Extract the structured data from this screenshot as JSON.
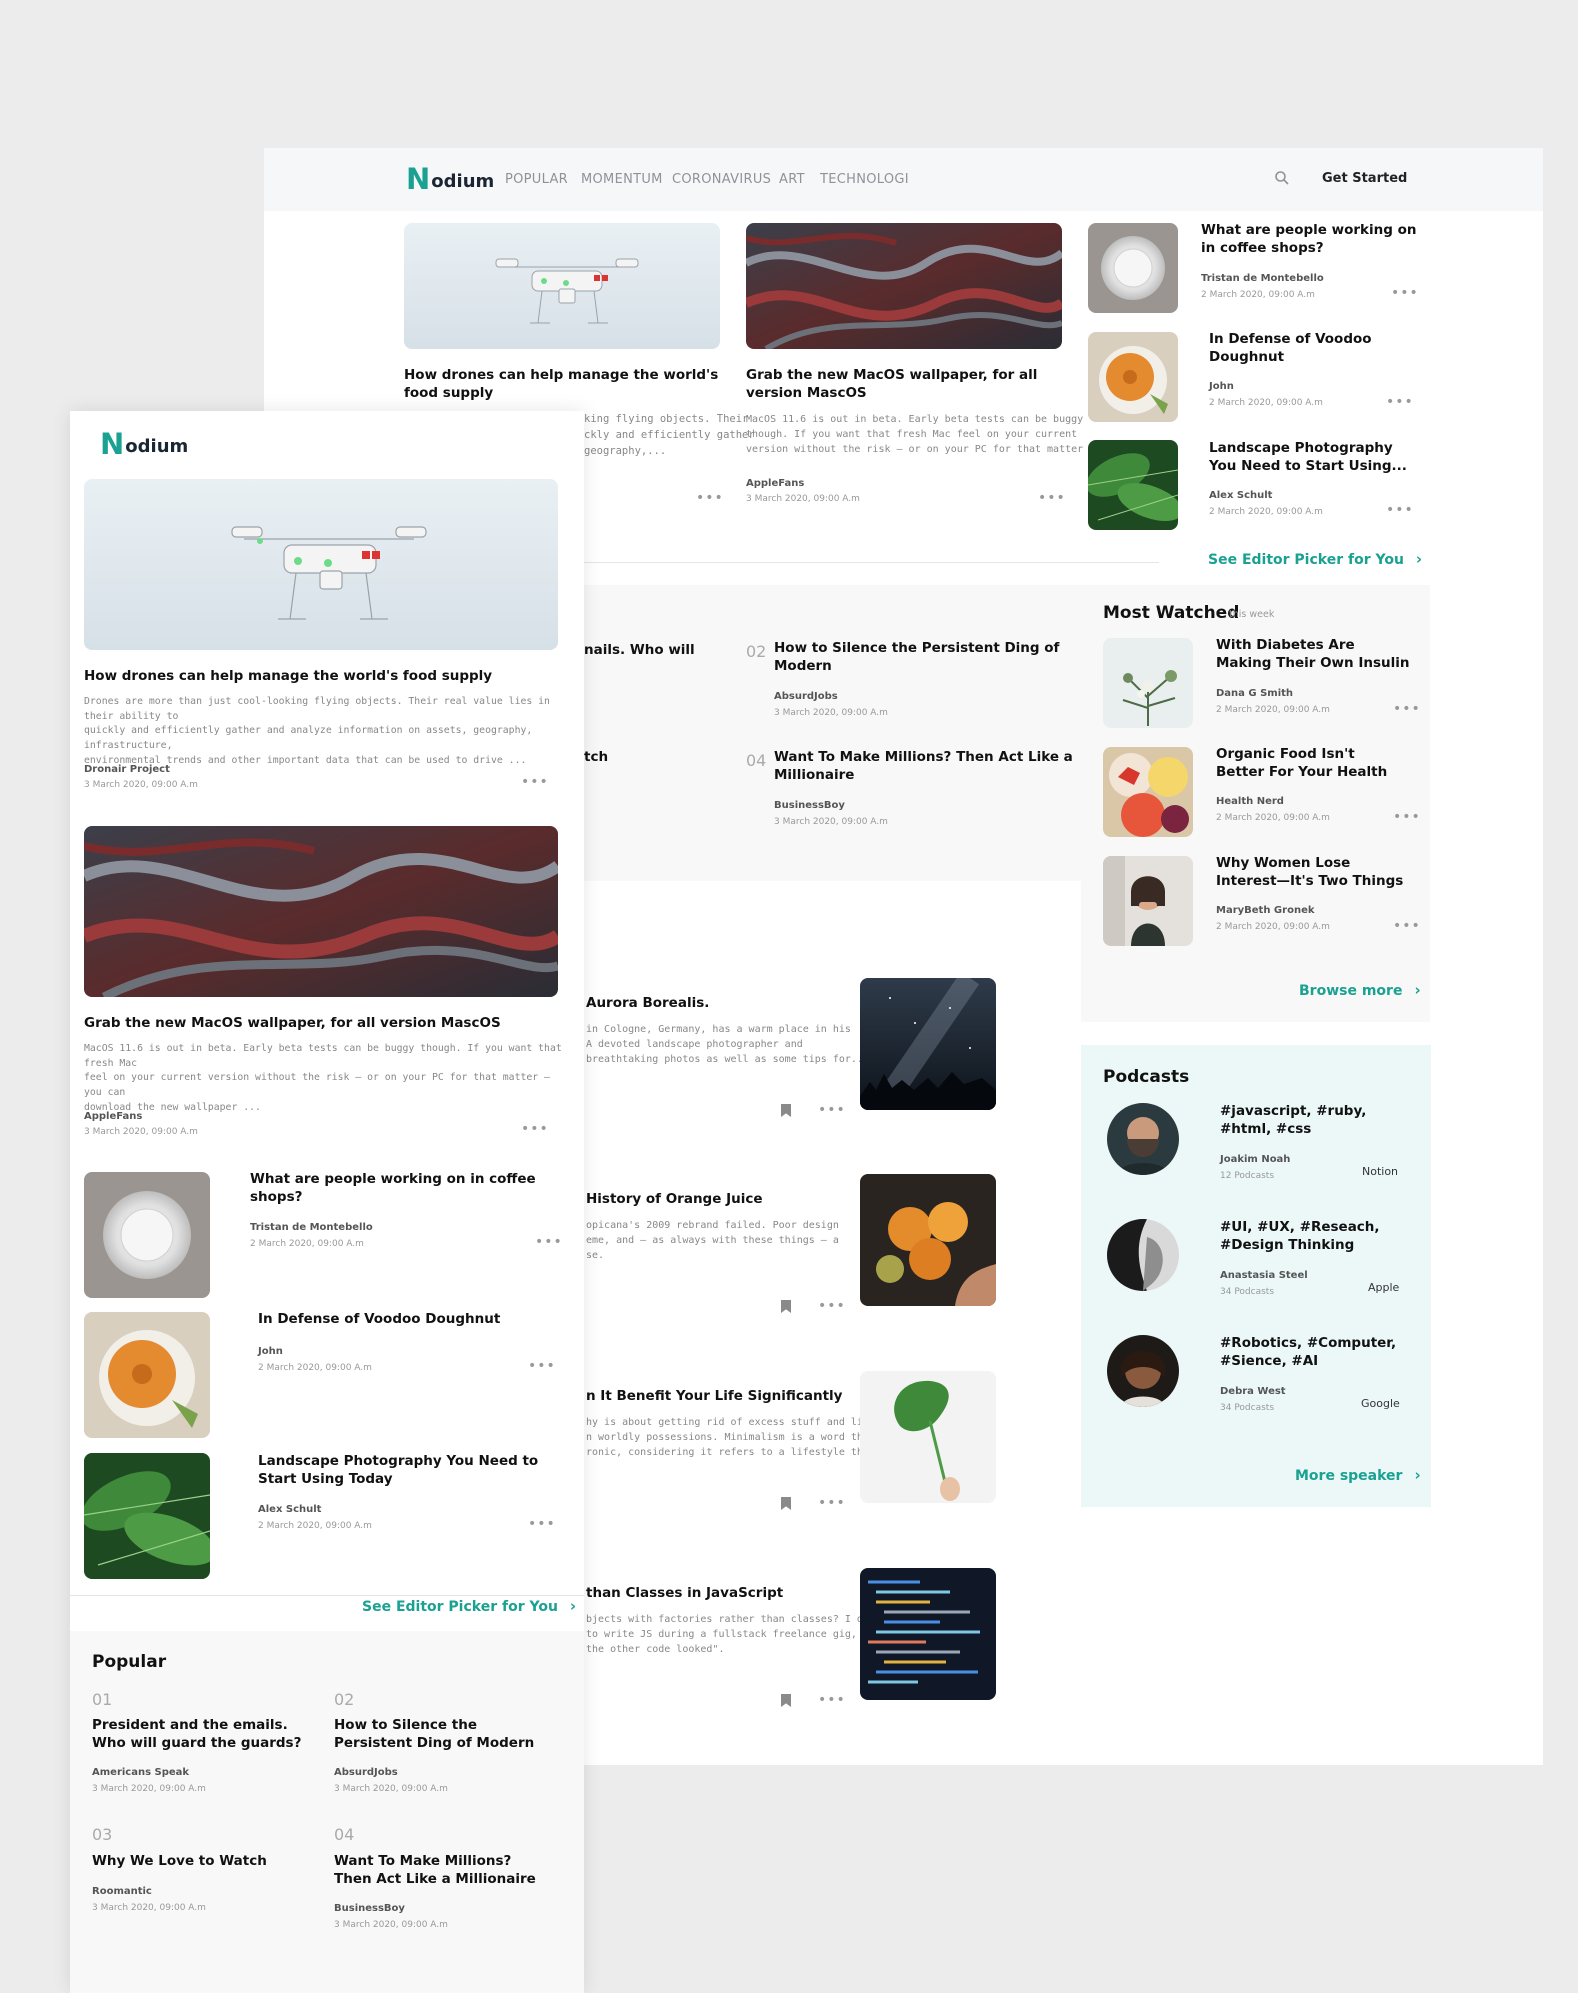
{
  "brand": {
    "logo_n": "N",
    "logo_rest": "odium"
  },
  "nav": {
    "items": [
      "POPULAR",
      "MOMENTUM",
      "CORONAVIRUS",
      "ART",
      "TECHNOLOGI"
    ],
    "get_started": "Get Started"
  },
  "colors": {
    "accent": "#1aa191",
    "background": "#ececec",
    "mint": "#ecf8f8"
  },
  "desktop": {
    "featured": [
      {
        "title_l1": "How drones can help manage the world's",
        "title_l2": "food supply",
        "excerpt_l1": "king flying objects. Their",
        "excerpt_l2": "ckly and efficiently gather",
        "excerpt_l3": "geography,...",
        "image": "drone"
      },
      {
        "title_l1": "Grab the new MacOS wallpaper, for all",
        "title_l2": "version MascOS",
        "excerpt_l1": "MacOS 11.6 is out in beta. Early beta tests can be buggy",
        "excerpt_l2": "though. If you want that fresh Mac feel on your current",
        "excerpt_l3": "version without the risk — or on your PC for that matter —...",
        "author": "AppleFans",
        "date": "3 March 2020, 09:00 A.m",
        "image": "marble"
      }
    ],
    "side_list": [
      {
        "title_l1": "What are people working on",
        "title_l2": "in coffee shops?",
        "author": "Tristan de Montebello",
        "date": "2 March 2020, 09:00 A.m",
        "image": "plate"
      },
      {
        "title_l1": "In Defense of Voodoo",
        "title_l2": "Doughnut",
        "author": "John",
        "date": "2 March 2020, 09:00 A.m",
        "image": "doughnut"
      },
      {
        "title_l1": "Landscape Photography",
        "title_l2": "You Need to Start Using...",
        "author": "Alex Schult",
        "date": "2 March 2020, 09:00 A.m",
        "image": "leaves"
      }
    ],
    "see_editor": "See Editor Picker for You",
    "popular": [
      {
        "title_frag": "nails. Who will"
      },
      {
        "num": "02",
        "title_l1": "How to Silence the Persistent Ding of",
        "title_l2": "Modern",
        "author": "AbsurdJobs",
        "date": "3 March 2020, 09:00 A.m"
      },
      {
        "title_frag": "tch"
      },
      {
        "num": "04",
        "title_l1": "Want To Make Millions? Then Act Like a",
        "title_l2": "Millionaire",
        "author": "BusinessBoy",
        "date": "3 March 2020, 09:00 A.m"
      }
    ],
    "articles": [
      {
        "title": "Aurora Borealis.",
        "ex1": "in Cologne, Germany, has a warm place in his",
        "ex2": "A devoted landscape photographer and",
        "ex3": "breathtaking photos as well as some tips for...",
        "image": "sky"
      },
      {
        "title": "History of Orange Juice",
        "ex1": "opicana's 2009 rebrand failed. Poor design",
        "ex2": "eme, and — as always with these things — a",
        "ex3": "se.",
        "image": "oranges"
      },
      {
        "title": "n It Benefit Your Life Significantly",
        "ex1": "hy is about getting rid of excess stuff and living",
        "ex2": "n worldly possessions. Minimalism is a word that",
        "ex3": "ronic, considering it refers to a lifestyle that is...",
        "image": "monstera"
      },
      {
        "title": "than Classes in JavaScript",
        "ex1": "bjects with factories rather than classes? I did",
        "ex2": "to write JS during a fullstack freelance gig, I",
        "ex3": "the other code looked\".",
        "image": "code"
      }
    ],
    "most_watched": {
      "title": "Most Watched",
      "sub": "this week",
      "items": [
        {
          "title_l1": "With Diabetes Are",
          "title_l2": "Making Their Own Insulin",
          "author": "Dana G Smith",
          "date": "2 March 2020, 09:00 A.m",
          "image": "flowers"
        },
        {
          "title_l1": "Organic Food Isn't",
          "title_l2": "Better For Your Health",
          "author": "Health Nerd",
          "date": "2 March 2020, 09:00 A.m",
          "image": "fruit"
        },
        {
          "title_l1": "Why Women Lose",
          "title_l2": "Interest—It's Two Things",
          "author": "MaryBeth Gronek",
          "date": "2 March 2020, 09:00 A.m",
          "image": "woman"
        }
      ],
      "browse_more": "Browse more"
    },
    "podcasts": {
      "title": "Podcasts",
      "items": [
        {
          "tags_l1": "#javascript, #ruby,",
          "tags_l2": "#html, #css",
          "name": "Joakim Noah",
          "count": "12 Podcasts",
          "platform": "Notion"
        },
        {
          "tags_l1": "#UI, #UX, #Reseach,",
          "tags_l2": "#Design Thinking",
          "name": "Anastasia Steel",
          "count": "34 Podcasts",
          "platform": "Apple"
        },
        {
          "tags_l1": "#Robotics, #Computer,",
          "tags_l2": "#Sience, #AI",
          "name": "Debra West",
          "count": "34 Podcasts",
          "platform": "Google"
        }
      ],
      "more": "More speaker"
    }
  },
  "mobile": {
    "featured": [
      {
        "title": "How drones can help manage the world's food supply",
        "ex1": "Drones are more than just cool-looking flying objects. Their real value lies in their ability to",
        "ex2": "quickly and efficiently gather and analyze information on assets, geography, infrastructure,",
        "ex3": "environmental trends and other important data that can be used to drive ...",
        "author": "Dronair Project",
        "date": "3 March 2020, 09:00 A.m"
      },
      {
        "title": "Grab the new MacOS wallpaper, for all version MascOS",
        "ex1": "MacOS 11.6 is out in beta. Early beta tests can be buggy though. If you want that fresh Mac",
        "ex2": "feel on your current version without the risk — or on your PC for that matter — you can",
        "ex3": "download the new wallpaper ...",
        "author": "AppleFans",
        "date": "3 March 2020, 09:00 A.m"
      }
    ],
    "list": [
      {
        "title_l1": "What are people working on in coffee",
        "title_l2": "shops?",
        "author": "Tristan de Montebello",
        "date": "2 March 2020, 09:00 A.m"
      },
      {
        "title_l1": "In Defense of Voodoo Doughnut",
        "title_l2": "",
        "author": "John",
        "date": "2 March 2020, 09:00 A.m"
      },
      {
        "title_l1": "Landscape Photography You Need to",
        "title_l2": "Start Using Today",
        "author": "Alex Schult",
        "date": "2 March 2020, 09:00 A.m"
      }
    ],
    "see_editor": "See Editor Picker for You",
    "popular": {
      "title": "Popular",
      "items": [
        {
          "num": "01",
          "title_l1": "President and the emails.",
          "title_l2": "Who will guard the guards?",
          "author": "Americans Speak",
          "date": "3 March 2020, 09:00 A.m"
        },
        {
          "num": "02",
          "title_l1": "How to Silence the",
          "title_l2": "Persistent Ding of Modern",
          "author": "AbsurdJobs",
          "date": "3 March 2020, 09:00 A.m"
        },
        {
          "num": "03",
          "title_l1": "Why We Love to Watch",
          "title_l2": "",
          "author": "Roomantic",
          "date": "3 March 2020, 09:00 A.m"
        },
        {
          "num": "04",
          "title_l1": "Want To Make Millions?",
          "title_l2": "Then Act Like a Millionaire",
          "author": "BusinessBoy",
          "date": "3 March 2020, 09:00 A.m"
        }
      ]
    }
  }
}
